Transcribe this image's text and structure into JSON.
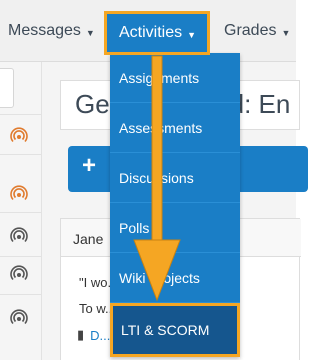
{
  "topnav": {
    "messages_label": "Messages",
    "activities_label": "Activities",
    "grades_label": "Grades"
  },
  "main": {
    "page_title": "General Board: En",
    "add_button_label": "+",
    "post": {
      "author": "Jane",
      "line1": "\"I wo... happy th",
      "line2": "To w... of Jane?",
      "link_label": "D... ussion 1"
    }
  },
  "activities_menu": {
    "items": [
      {
        "label": "Assignments"
      },
      {
        "label": "Assessments"
      },
      {
        "label": "Discussions"
      },
      {
        "label": "Polls"
      },
      {
        "label": "Wiki Projects"
      },
      {
        "label": "LTI & SCORM"
      }
    ],
    "highlighted_item": "LTI & SCORM"
  },
  "colors": {
    "primary_blue": "#1a7ec6",
    "dark_blue": "#15568e",
    "highlight_orange": "#f5a623",
    "active_icon": "#e07b2e",
    "inactive_icon": "#555555"
  },
  "icons": {
    "caret": "chevron-down-icon",
    "left_rail": "broadcast-icon",
    "comment": "comment-icon",
    "annotation": "arrow-down-icon"
  }
}
